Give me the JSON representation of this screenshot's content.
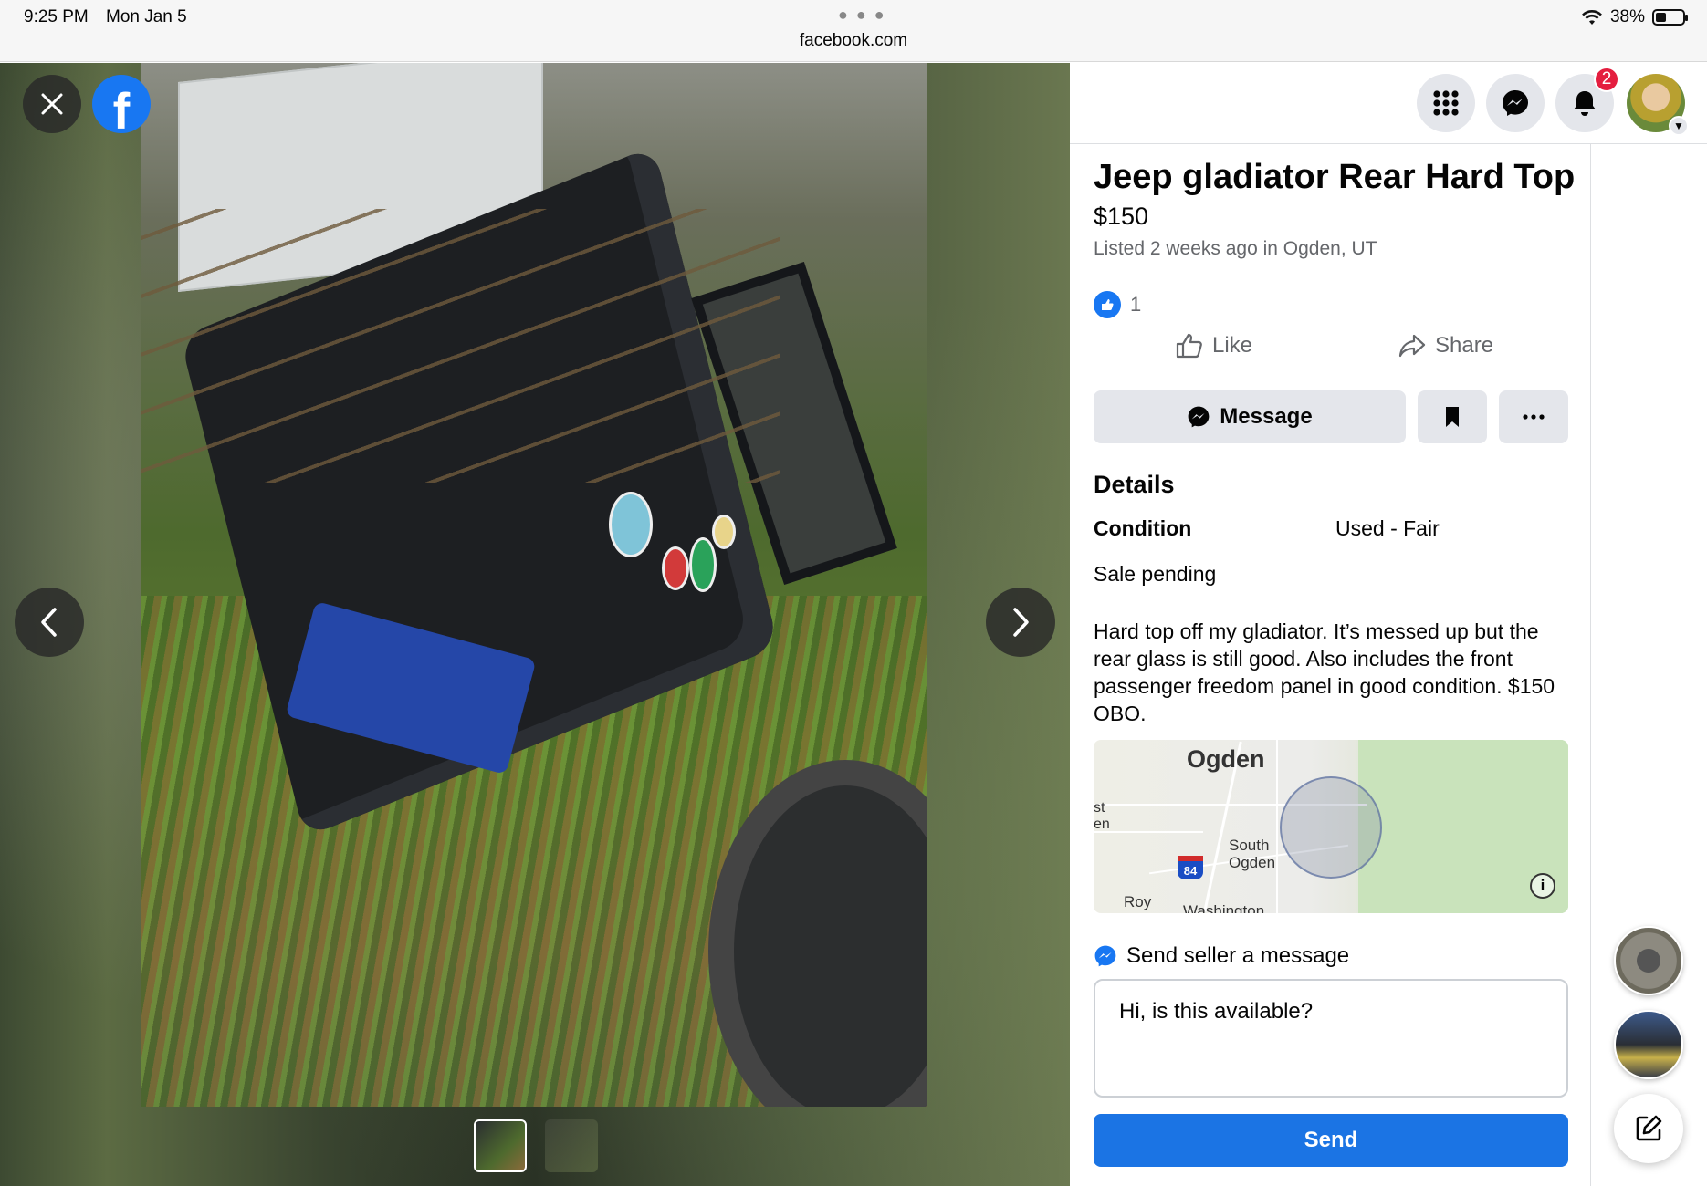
{
  "status_bar": {
    "time": "9:25 PM",
    "date": "Mon Jan 5",
    "url": "facebook.com",
    "battery": "38%",
    "battery_level": 0.38
  },
  "viewer": {
    "photo_count": 2,
    "selected_photo": 1
  },
  "nav": {
    "notification_count": "2"
  },
  "listing": {
    "title": "Jeep gladiator Rear Hard Top",
    "price": "$150",
    "listed": "Listed 2 weeks ago in Ogden, UT",
    "reaction_count": "1",
    "like_label": "Like",
    "share_label": "Share",
    "message_label": "Message",
    "details_heading": "Details",
    "condition_label": "Condition",
    "condition_value": "Used - Fair",
    "status": "Sale pending",
    "description": "Hard top off my gladiator. It’s messed up but the rear glass is still good. Also includes the front passenger freedom panel in good condition. $150 OBO."
  },
  "map": {
    "city": "Ogden",
    "south_ogden": "South\nOgden",
    "roy": "Roy",
    "washington": "Washington",
    "west_fragment_1": "st",
    "west_fragment_2": "en",
    "interstate": "84"
  },
  "message": {
    "send_label": "Send seller a message",
    "input_value": "Hi, is this available?",
    "send_button": "Send"
  },
  "colors": {
    "brand_blue": "#1877f2",
    "send_blue": "#1b74e4",
    "badge_red": "#e41e3f"
  }
}
